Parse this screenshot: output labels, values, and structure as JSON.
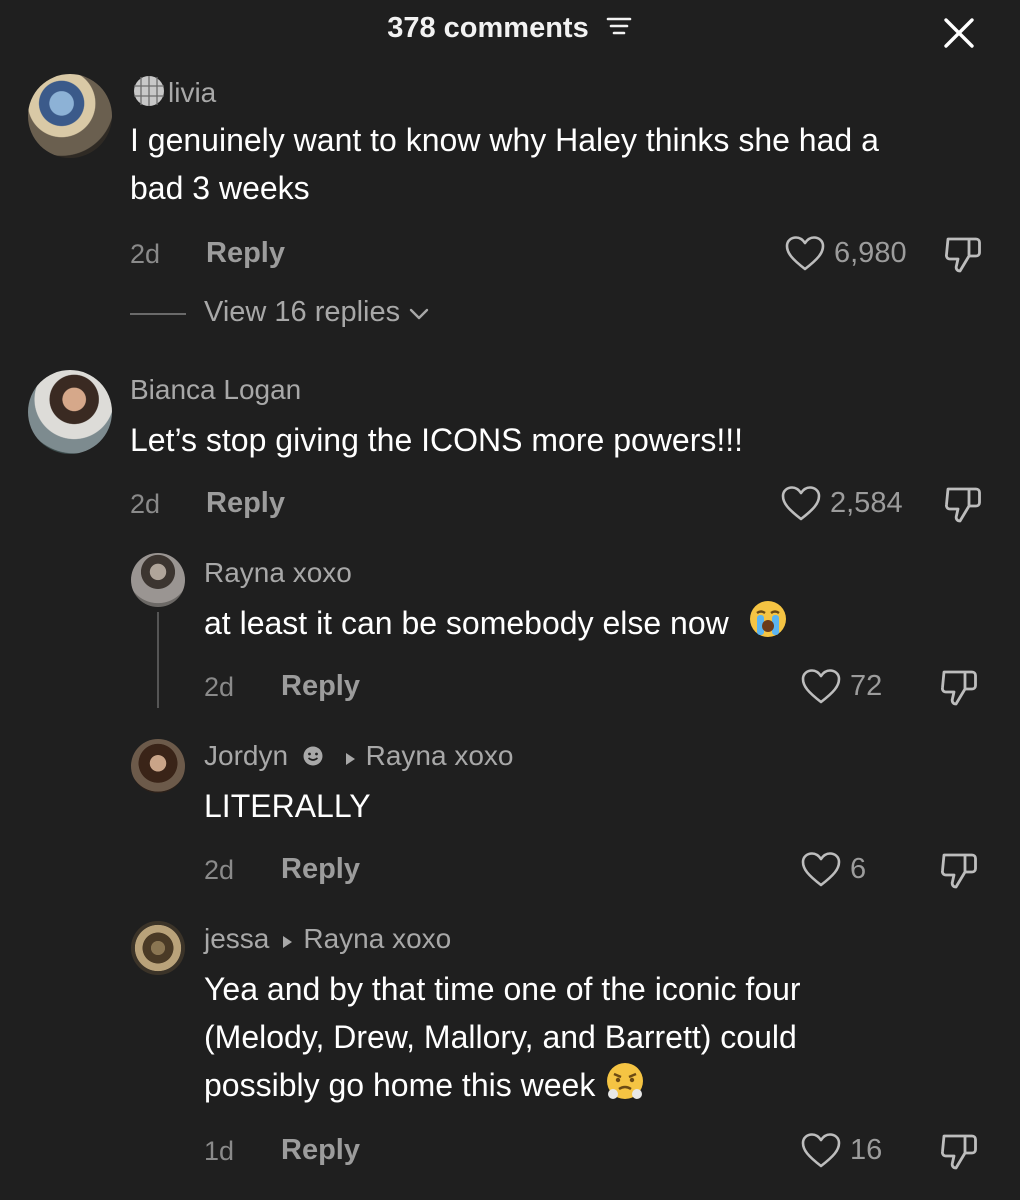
{
  "header": {
    "title": "378 comments"
  },
  "comments": [
    {
      "username": "livia",
      "text_lines": [
        "I genuinely want to know why Haley thinks she had a",
        "bad 3 weeks"
      ],
      "time": "2d",
      "reply_label": "Reply",
      "likes": "6,980",
      "view_replies": "View 16 replies"
    },
    {
      "username": "Bianca Logan",
      "text_lines": [
        "Let’s stop giving the ICONS more powers!!!"
      ],
      "time": "2d",
      "reply_label": "Reply",
      "likes": "2,584"
    }
  ],
  "replies": [
    {
      "username": "Rayna xoxo",
      "text": "at least it can be somebody else now",
      "emoji": "loudly-crying-face",
      "time": "2d",
      "reply_label": "Reply",
      "likes": "72"
    },
    {
      "username": "Jordyn",
      "reply_to": "Rayna xoxo",
      "text": "LITERALLY",
      "time": "2d",
      "reply_label": "Reply",
      "likes": "6"
    },
    {
      "username": "jessa",
      "reply_to": "Rayna xoxo",
      "text_lines": [
        "Yea and by that time one of the iconic four",
        "(Melody, Drew, Mallory, and Barrett) could",
        "possibly go home this week"
      ],
      "emoji": "face-with-steam-from-nose",
      "time": "1d",
      "reply_label": "Reply",
      "likes": "16"
    }
  ],
  "colors": {
    "background": "#1f1f1f",
    "text": "#ffffff",
    "muted": "#9c9c9c"
  }
}
